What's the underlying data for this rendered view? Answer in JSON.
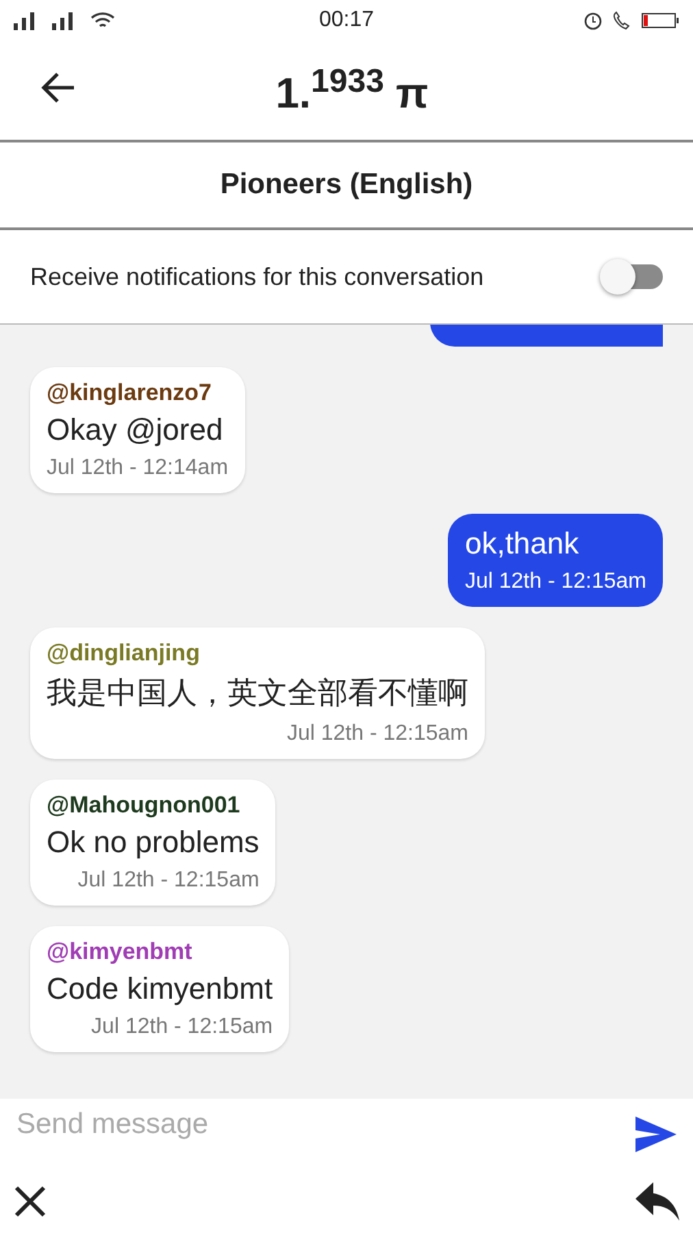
{
  "status_bar": {
    "time": "00:17"
  },
  "header": {
    "title": "1.$^{1933}$ π"
  },
  "channel": {
    "name": "Pioneers (English)"
  },
  "notifications": {
    "label": "Receive notifications for this conversation",
    "on": false
  },
  "messages": [
    {
      "kind": "outgoing",
      "partial": true
    },
    {
      "kind": "incoming",
      "author": "@kinglarenzo7",
      "color": "#6b3a10",
      "text": "Okay @jored",
      "time": "Jul 12th - 12:14am"
    },
    {
      "kind": "outgoing",
      "text": "ok,thank",
      "time": "Jul 12th - 12:15am"
    },
    {
      "kind": "incoming",
      "author": "@dinglianjing",
      "color": "#7a7a26",
      "text": "我是中国人，英文全部看不懂啊",
      "time": "Jul 12th - 12:15am"
    },
    {
      "kind": "incoming",
      "author": "@Mahougnon001",
      "color": "#1e3a1e",
      "text": "Ok no problems",
      "time": "Jul 12th - 12:15am"
    },
    {
      "kind": "incoming",
      "author": "@kimyenbmt",
      "color": "#a03cb4",
      "text": "Code kimyenbmt",
      "time": "Jul 12th - 12:15am"
    }
  ],
  "composer": {
    "placeholder": "Send message"
  }
}
